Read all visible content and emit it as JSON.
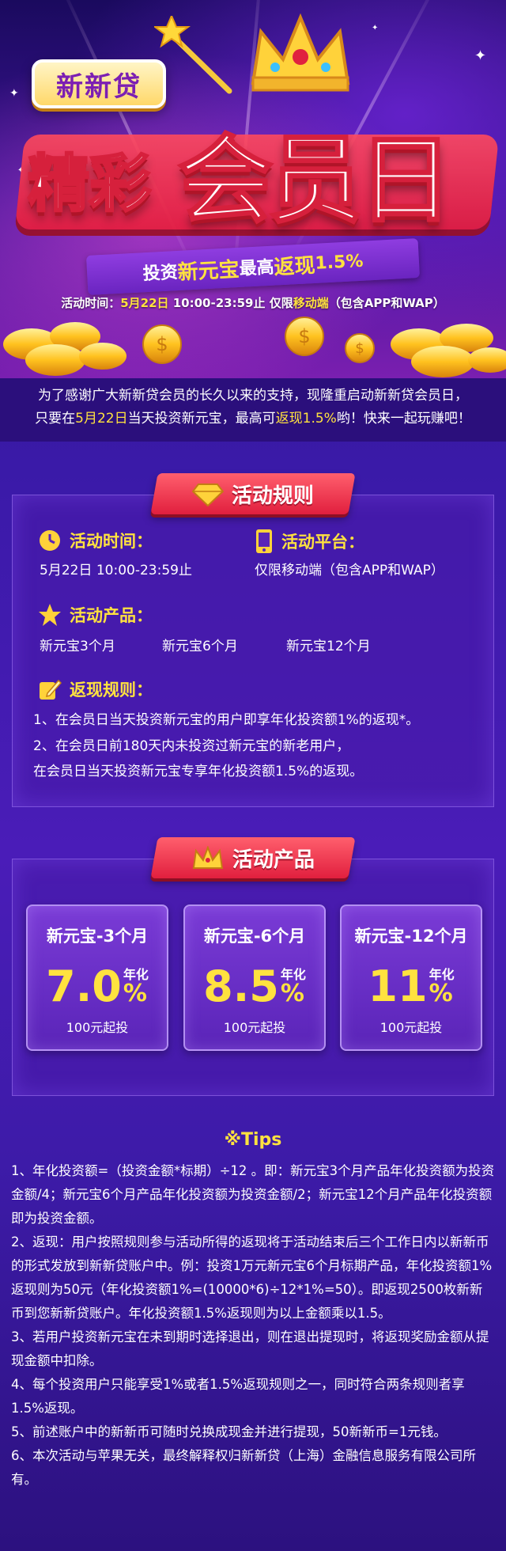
{
  "hero": {
    "brand": "新新贷",
    "title_1": "精彩",
    "title_2": "会员日",
    "ribbon_pre": "投资",
    "ribbon_product": "新元宝",
    "ribbon_mid": "最高",
    "ribbon_cash": "返现",
    "ribbon_rate": "1.5%",
    "info_label": "活动时间：",
    "info_date": "5月22日",
    "info_time": " 10:00-23:59止 ",
    "info_only": "仅限",
    "info_mobile": "移动端",
    "info_tail": "（包含APP和WAP）"
  },
  "intro": {
    "p1": "为了感谢广大新新贷会员的长久以来的支持，现隆重启动新新贷会员日，",
    "p2a": "只要在",
    "p2_date": "5月22日",
    "p2b": "当天投资新元宝，最高可",
    "p2_rate": "返现1.5%",
    "p2c": "哟！快来一起玩赚吧！"
  },
  "rules": {
    "heading": "活动规则",
    "time_h": "活动时间：",
    "time_v": "5月22日 10:00-23:59止",
    "platform_h": "活动平台：",
    "platform_v": "仅限移动端（包含APP和WAP）",
    "product_h": "活动产品：",
    "products": [
      "新元宝3个月",
      "新元宝6个月",
      "新元宝12个月"
    ],
    "cash_h": "返现规则：",
    "cash_1": "1、在会员日当天投资新元宝的用户即享年化投资额1%的返现*。",
    "cash_2": "2、在会员日前180天内未投资过新元宝的新老用户，",
    "cash_3": "在会员日当天投资新元宝专享年化投资额1.5%的返现。"
  },
  "products": {
    "heading": "活动产品",
    "items": [
      {
        "name": "新元宝-3个月",
        "rate": "7.0",
        "unit_top": "年化",
        "unit": "%",
        "min": "100元起投"
      },
      {
        "name": "新元宝-6个月",
        "rate": "8.5",
        "unit_top": "年化",
        "unit": "%",
        "min": "100元起投"
      },
      {
        "name": "新元宝-12个月",
        "rate": "11",
        "unit_top": "年化",
        "unit": "%",
        "min": "100元起投"
      }
    ]
  },
  "tips": {
    "title": "※Tips",
    "items": [
      "1、年化投资额=（投资金额*标期）÷12 。即：新元宝3个月产品年化投资额为投资金额/4；新元宝6个月产品年化投资额为投资金额/2；新元宝12个月产品年化投资额即为投资金额。",
      "2、返现：用户按照规则参与活动所得的返现将于活动结束后三个工作日内以新新币的形式发放到新新贷账户中。例：投资1万元新元宝6个月标期产品，年化投资额1%返现则为50元（年化投资额1%=(10000*6)÷12*1%=50）。即返现2500枚新新币到您新新贷账户。年化投资额1.5%返现则为以上金额乘以1.5。",
      "3、若用户投资新元宝在未到期时选择退出，则在退出提现时，将返现奖励金额从提现金额中扣除。",
      "4、每个投资用户只能享受1%或者1.5%返现规则之一，同时符合两条规则者享1.5%返现。",
      "5、前述账户中的新新币可随时兑换成现金并进行提现，50新新币=1元钱。",
      "6、本次活动与苹果无关，最终解释权归新新贷（上海）金融信息服务有限公司所有。"
    ]
  },
  "colors": {
    "accent_yellow": "#ffe23f",
    "accent_red": "#e81e3b",
    "background_purple": "#3a1aa8"
  }
}
